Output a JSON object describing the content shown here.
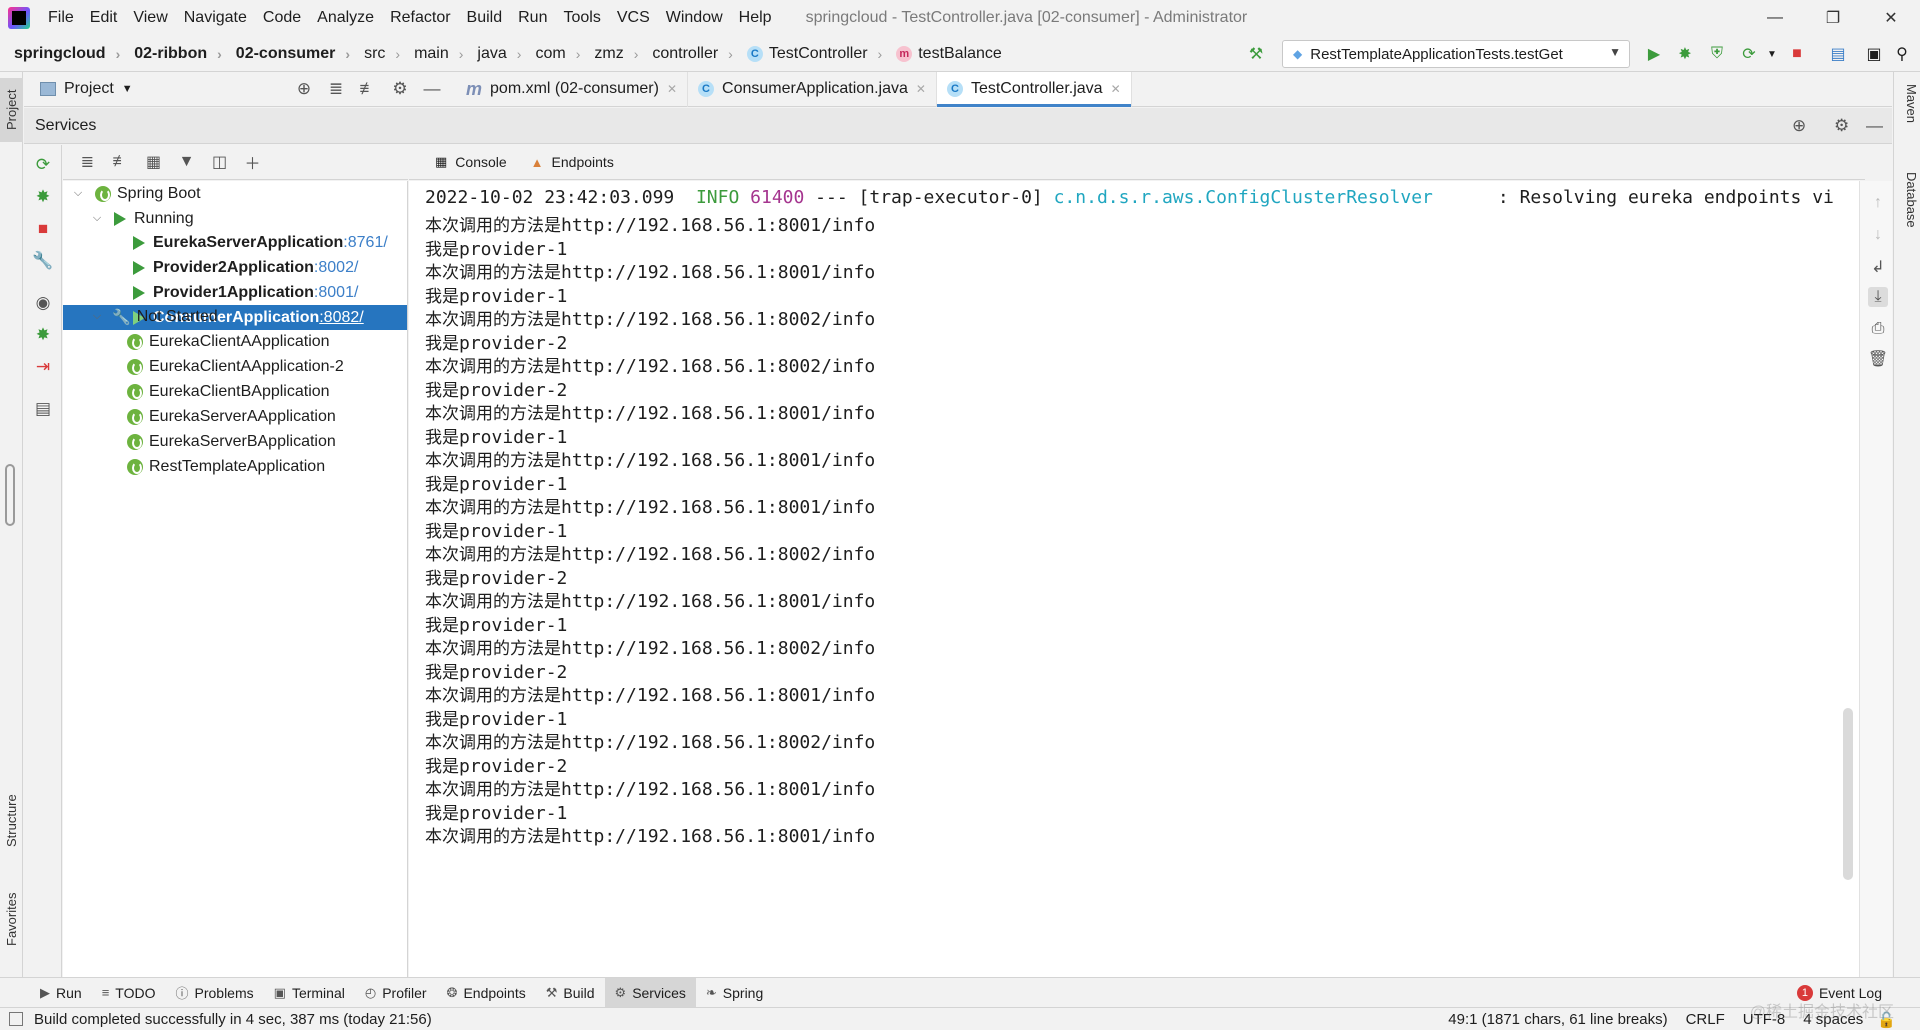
{
  "menubar": {
    "items": [
      "File",
      "Edit",
      "View",
      "Navigate",
      "Code",
      "Analyze",
      "Refactor",
      "Build",
      "Run",
      "Tools",
      "VCS",
      "Window",
      "Help"
    ],
    "window_title": "springcloud - TestController.java [02-consumer] - Administrator"
  },
  "navbar": {
    "crumbs": [
      "springcloud",
      "02-ribbon",
      "02-consumer",
      "src",
      "main",
      "java",
      "com",
      "zmz",
      "controller",
      "TestController",
      "testBalance"
    ],
    "run_config": "RestTemplateApplicationTests.testGet"
  },
  "project_row": {
    "label": "Project",
    "tabs": [
      {
        "label": "pom.xml (02-consumer)",
        "icon": "maven-icon"
      },
      {
        "label": "ConsumerApplication.java",
        "icon": "class-icon"
      },
      {
        "label": "TestController.java",
        "icon": "class-icon",
        "active": true
      }
    ]
  },
  "left_stripe": {
    "top": "Project",
    "structure": "Structure",
    "favorites": "Favorites"
  },
  "right_stripe": {
    "maven": "Maven",
    "database": "Database"
  },
  "services": {
    "title": "Services",
    "tree": {
      "spring_boot": "Spring Boot",
      "running": "Running",
      "running_apps": [
        {
          "name": "EurekaServerApplication",
          "port": ":8761/"
        },
        {
          "name": "Provider2Application",
          "port": ":8002/"
        },
        {
          "name": "Provider1Application",
          "port": ":8001/"
        },
        {
          "name": "ConsumerApplication",
          "port": ":8082/"
        }
      ],
      "not_started": "Not Started",
      "stopped_apps": [
        "EurekaClientAApplication",
        "EurekaClientAApplication-2",
        "EurekaClientBApplication",
        "EurekaServerAApplication",
        "EurekaServerBApplication",
        "RestTemplateApplication"
      ]
    },
    "console_tabs": [
      "Console",
      "Endpoints"
    ]
  },
  "console": {
    "first_line": {
      "timestamp": "2022-10-02 23:42:03.099",
      "level": "INFO",
      "pid": "61400",
      "thread": "--- [trap-executor-0]",
      "logger": "c.n.d.s.r.aws.ConfigClusterResolver",
      "message": ": Resolving eureka endpoints vi"
    },
    "call_prefix": "本次调用的方法是",
    "reply_prefix": "我是",
    "lines": [
      [
        "call",
        "http://192.168.56.1:8001/info"
      ],
      [
        "reply",
        "provider-1"
      ],
      [
        "call",
        "http://192.168.56.1:8001/info"
      ],
      [
        "reply",
        "provider-1"
      ],
      [
        "call",
        "http://192.168.56.1:8002/info"
      ],
      [
        "reply",
        "provider-2"
      ],
      [
        "call",
        "http://192.168.56.1:8002/info"
      ],
      [
        "reply",
        "provider-2"
      ],
      [
        "call",
        "http://192.168.56.1:8001/info"
      ],
      [
        "reply",
        "provider-1"
      ],
      [
        "call",
        "http://192.168.56.1:8001/info"
      ],
      [
        "reply",
        "provider-1"
      ],
      [
        "call",
        "http://192.168.56.1:8001/info"
      ],
      [
        "reply",
        "provider-1"
      ],
      [
        "call",
        "http://192.168.56.1:8002/info"
      ],
      [
        "reply",
        "provider-2"
      ],
      [
        "call",
        "http://192.168.56.1:8001/info"
      ],
      [
        "reply",
        "provider-1"
      ],
      [
        "call",
        "http://192.168.56.1:8002/info"
      ],
      [
        "reply",
        "provider-2"
      ],
      [
        "call",
        "http://192.168.56.1:8001/info"
      ],
      [
        "reply",
        "provider-1"
      ],
      [
        "call",
        "http://192.168.56.1:8002/info"
      ],
      [
        "reply",
        "provider-2"
      ],
      [
        "call",
        "http://192.168.56.1:8001/info"
      ],
      [
        "reply",
        "provider-1"
      ],
      [
        "call",
        "http://192.168.56.1:8001/info"
      ]
    ]
  },
  "toolwindows": [
    "Run",
    "TODO",
    "Problems",
    "Terminal",
    "Profiler",
    "Endpoints",
    "Build",
    "Services",
    "Spring"
  ],
  "active_toolwindow": "Services",
  "event_log": {
    "label": "Event Log",
    "count": "1"
  },
  "statusbar": {
    "message": "Build completed successfully in 4 sec, 387 ms (today 21:56)",
    "position": "49:1 (1871 chars, 61 line breaks)",
    "line_sep": "CRLF",
    "encoding": "UTF-8",
    "indent": "4 spaces"
  },
  "watermark": "@稀土掘金技术社区",
  "colors": {
    "accent": "#2675bf",
    "run_green": "#3c9b3c",
    "info_green": "#3c9b3c",
    "pid_purple": "#a5358f",
    "logger_cyan": "#20a6c0"
  }
}
